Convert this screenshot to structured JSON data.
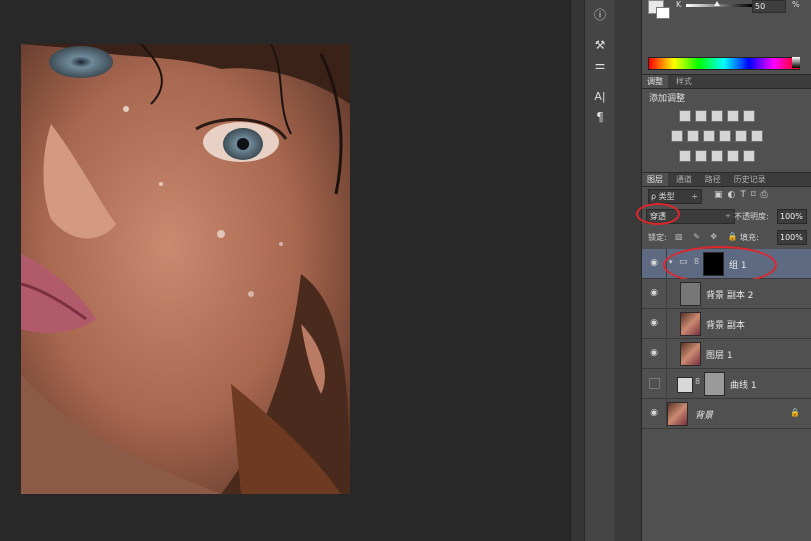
{
  "tools": {
    "info_icon": "info-icon",
    "brush_icon": "brush-presets-icon",
    "sliders_icon": "adjust-sliders-icon",
    "char_label": "A|",
    "para_label": "¶"
  },
  "color_panel": {
    "k_label": "K",
    "k_value": "50",
    "k_unit": "%"
  },
  "adjustments": {
    "tabs": [
      "调整",
      "样式"
    ],
    "title": "添加调整"
  },
  "layers_panel": {
    "tabs": [
      "图层",
      "通道",
      "路径",
      "历史记录"
    ],
    "filter_label": "ρ 类型",
    "filter_caret": "÷",
    "blend_mode": "穿透",
    "blend_caret": "÷",
    "opacity_label": "不透明度:",
    "opacity_value": "100%",
    "lock_label": "锁定:",
    "lock_icons": "▨ ✎ ✥ 🔒",
    "fill_label": "填充:",
    "fill_value": "100%",
    "layers": [
      {
        "name": "组 1"
      },
      {
        "name": "背景 副本 2"
      },
      {
        "name": "背景 副本"
      },
      {
        "name": "图层 1"
      },
      {
        "name": "曲线 1"
      },
      {
        "name": "背景"
      }
    ]
  },
  "colors": {
    "panel_bg": "#505050",
    "selected_layer": "#5d6a82",
    "annotation_red": "#e0262a",
    "canvas_bg": "#282828"
  }
}
